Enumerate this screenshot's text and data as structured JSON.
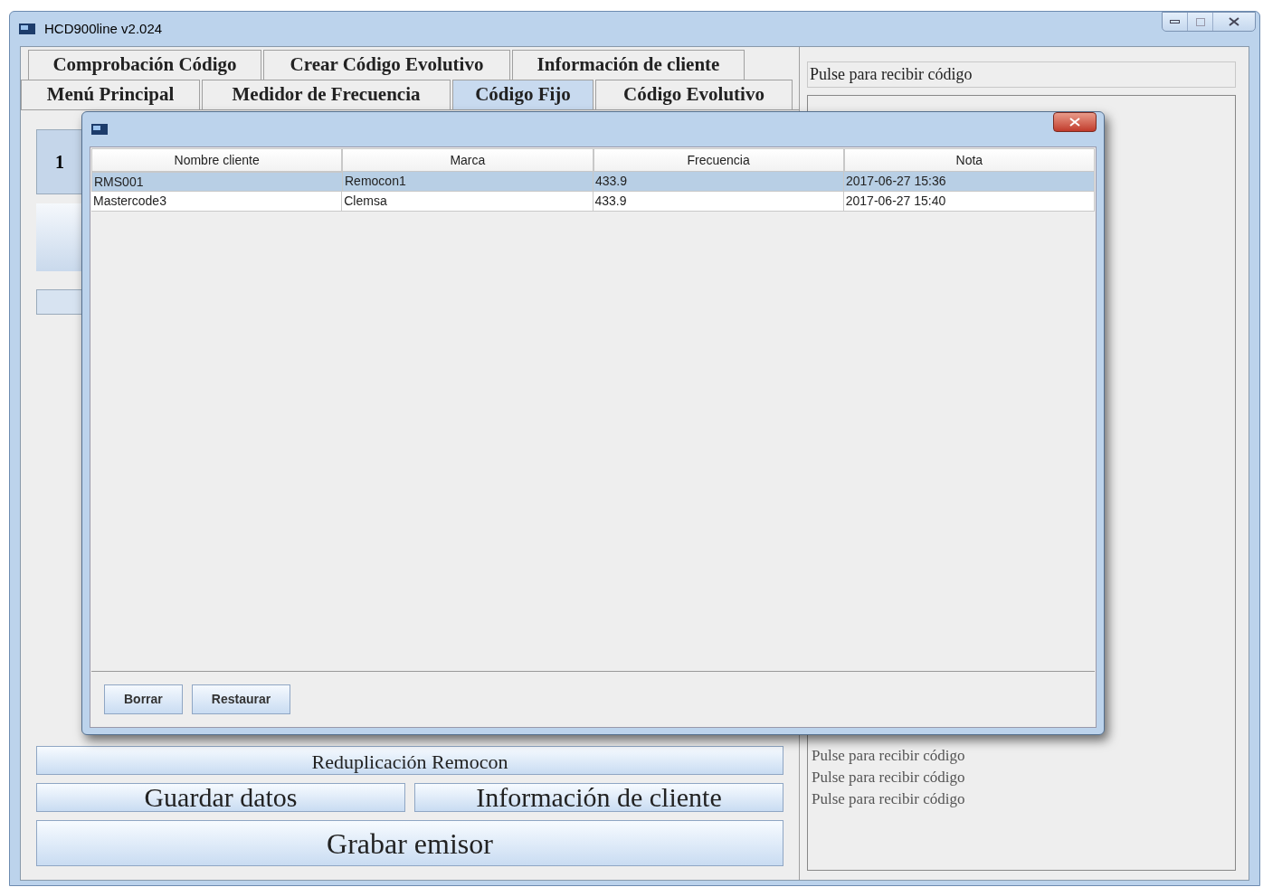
{
  "window": {
    "title": "HCD900line  v2.024"
  },
  "tabs": {
    "rows": [
      [
        {
          "label": "Comprobación Código",
          "selected": false
        },
        {
          "label": "Crear Código Evolutivo",
          "selected": false
        },
        {
          "label": "Información de cliente",
          "selected": false
        }
      ],
      [
        {
          "label": "Menú Principal",
          "selected": false
        },
        {
          "label": "Medidor de Frecuencia",
          "selected": false
        },
        {
          "label": "Código Fijo",
          "selected": true
        },
        {
          "label": "Código Evolutivo",
          "selected": false
        }
      ]
    ]
  },
  "left_panel": {
    "side_button": "1",
    "buttons": [
      {
        "kind": "wide",
        "label": "Reduplicación Remocon"
      },
      {
        "kind": "half",
        "label": "Guardar datos"
      },
      {
        "kind": "half",
        "label": "Información de cliente"
      },
      {
        "kind": "big",
        "label": "Grabar emisor"
      }
    ]
  },
  "right_panel": {
    "field_value": "Pulse para recibir código",
    "log": [
      "Pulse para recibir código",
      "Pulse para recibir código",
      "Pulse para recibir código"
    ]
  },
  "dialog": {
    "table": {
      "columns": [
        "Nombre cliente",
        "Marca",
        "Frecuencia",
        "Nota"
      ],
      "rows": [
        {
          "cells": [
            "RMS001",
            "Remocon1",
            "433.9",
            "2017-06-27 15:36"
          ],
          "selected": true
        },
        {
          "cells": [
            "Mastercode3",
            "Clemsa",
            "433.9",
            "2017-06-27 15:40"
          ],
          "selected": false
        }
      ]
    },
    "buttons": [
      "Borrar",
      "Restaurar"
    ]
  }
}
